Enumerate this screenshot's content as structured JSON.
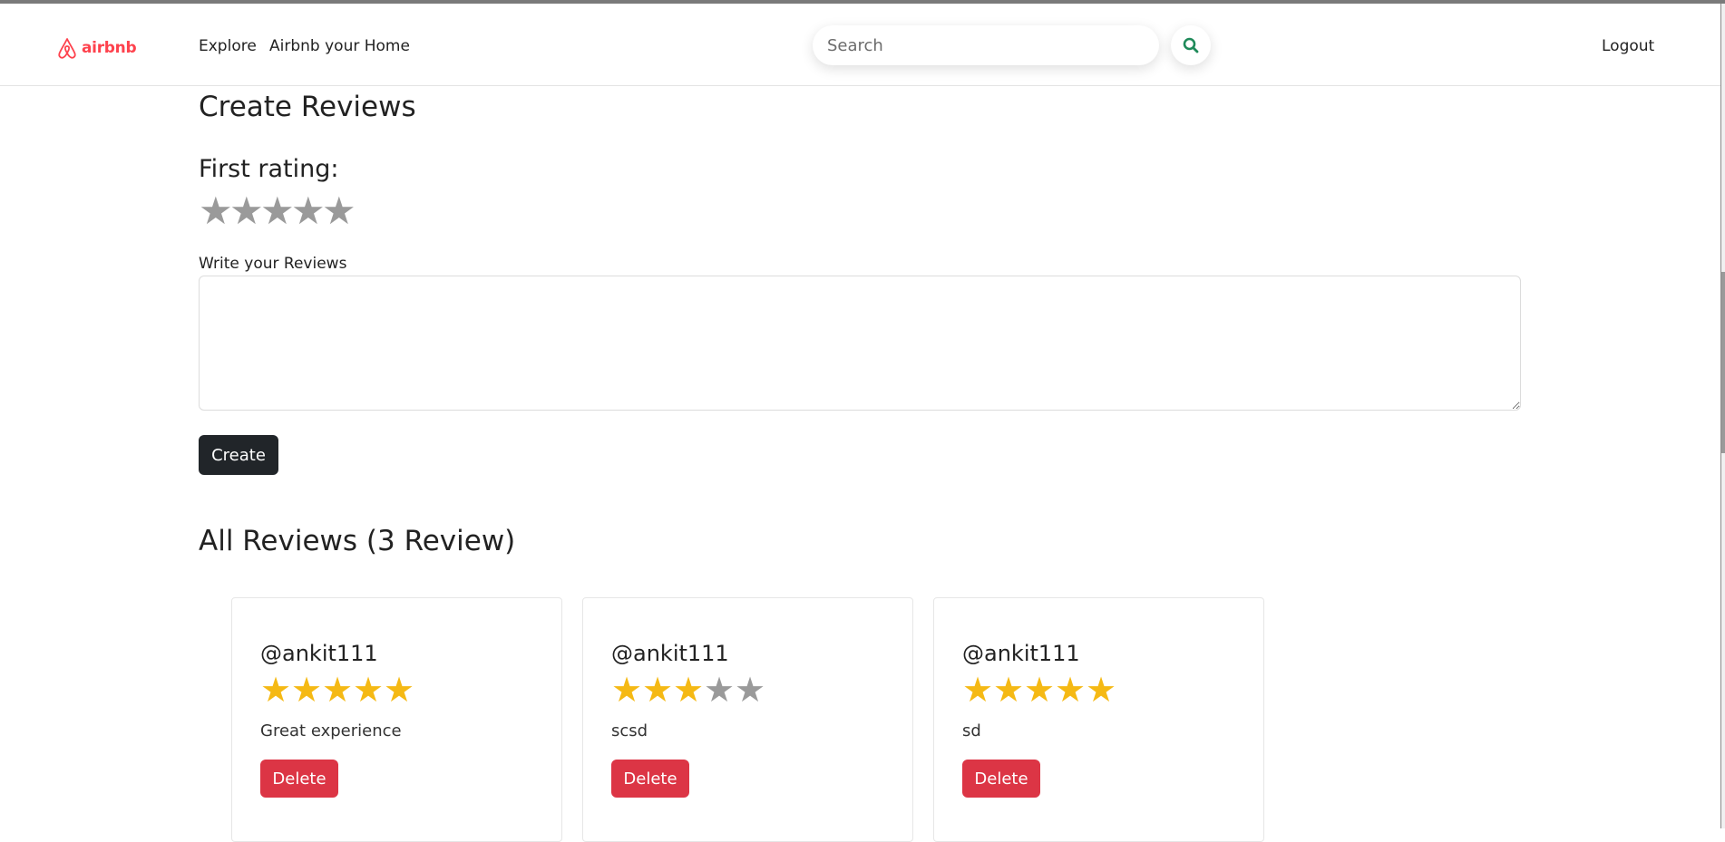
{
  "navbar": {
    "logo_text": "airbnb",
    "links": [
      "Explore",
      "Airbnb your Home"
    ],
    "search_placeholder": "Search",
    "logout_label": "Logout",
    "brand_color": "#fe424d",
    "search_icon_color": "#1f8a5a"
  },
  "create_review": {
    "title": "Create Reviews",
    "rating_label": "First rating:",
    "rating_value": 0,
    "rating_max": 5,
    "review_label": "Write your Reviews",
    "review_value": "",
    "create_label": "Create"
  },
  "reviews": {
    "title": "All Reviews (3 Review)",
    "items": [
      {
        "author": "@ankit111",
        "rating": 5,
        "comment": "Great experience",
        "delete_label": "Delete"
      },
      {
        "author": "@ankit111",
        "rating": 3,
        "comment": "scsd",
        "delete_label": "Delete"
      },
      {
        "author": "@ankit111",
        "rating": 5,
        "comment": "sd",
        "delete_label": "Delete"
      }
    ]
  },
  "colors": {
    "star_filled": "#f5b914",
    "star_empty": "#9a9a9a",
    "delete_button": "#dc3545",
    "create_button": "#212529"
  }
}
